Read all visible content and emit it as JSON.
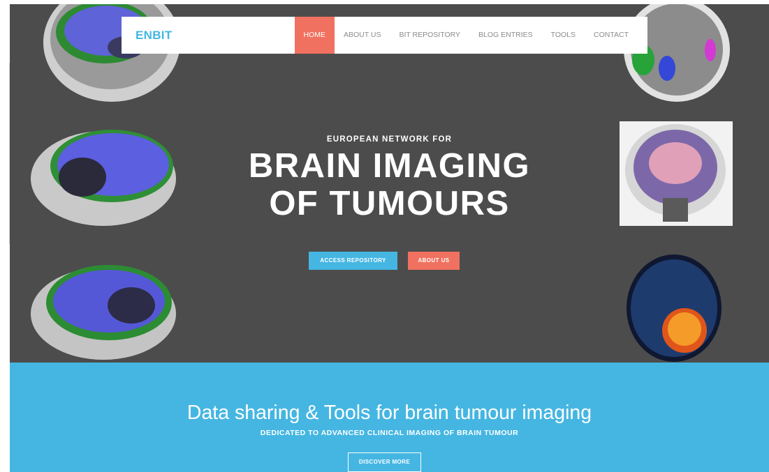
{
  "navbar": {
    "logo": "ENBIT",
    "items": [
      {
        "label": "HOME",
        "active": true
      },
      {
        "label": "ABOUT US",
        "active": false
      },
      {
        "label": "BIT REPOSITORY",
        "active": false
      },
      {
        "label": "BLOG ENTRIES",
        "active": false
      },
      {
        "label": "TOOLS",
        "active": false
      },
      {
        "label": "CONTACT",
        "active": false
      }
    ]
  },
  "hero": {
    "kicker": "EUROPEAN NETWORK FOR",
    "headline_line1": "BRAIN IMAGING",
    "headline_line2": "OF TUMOURS",
    "buttons": {
      "access_repository": "ACCESS REPOSITORY",
      "about_us": "ABOUT US"
    }
  },
  "band": {
    "title": "Data sharing & Tools for brain tumour imaging",
    "subtitle": "DEDICATED TO ADVANCED CLINICAL IMAGING OF BRAIN TUMOUR",
    "button": "DISCOVER MORE"
  },
  "colors": {
    "accent_blue": "#45b6e2",
    "accent_coral": "#f0715f",
    "hero_background": "#4c4c4c"
  }
}
